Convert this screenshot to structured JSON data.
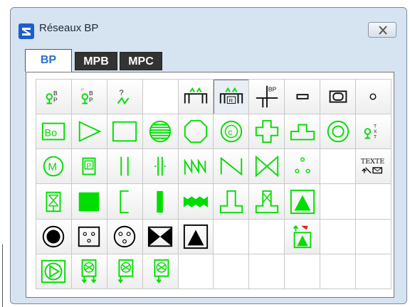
{
  "window": {
    "title": "Réseaux BP"
  },
  "tabs": [
    {
      "label": "BP",
      "active": true
    },
    {
      "label": "MPB",
      "active": false
    },
    {
      "label": "MPC",
      "active": false
    }
  ],
  "cells": [
    {
      "name": "bp-node-symbol",
      "icon": "bp-node"
    },
    {
      "name": "bp-node-alt-symbol",
      "icon": "bp-node-alt"
    },
    {
      "name": "fault-marker-symbol",
      "icon": "fault-marker"
    },
    {
      "name": "empty",
      "icon": "blank"
    },
    {
      "name": "span-aa-symbol",
      "icon": "span-aa"
    },
    {
      "name": "span-aa-r-symbol",
      "icon": "span-aa-r",
      "pressed": true
    },
    {
      "name": "bp-cross-symbol",
      "icon": "bp-cross"
    },
    {
      "name": "small-rect-symbol",
      "icon": "small-rect"
    },
    {
      "name": "box-symbol",
      "icon": "box"
    },
    {
      "name": "small-circle-symbol",
      "icon": "small-circle"
    },
    {
      "name": "bo-box-symbol",
      "icon": "bo-box"
    },
    {
      "name": "triangle-right-symbol",
      "icon": "triangle-right"
    },
    {
      "name": "rectangle-symbol",
      "icon": "rectangle"
    },
    {
      "name": "striped-circle-symbol",
      "icon": "striped-circle"
    },
    {
      "name": "octagon-symbol",
      "icon": "octagon"
    },
    {
      "name": "c-circle-symbol",
      "icon": "c-circle"
    },
    {
      "name": "cross-shape-symbol",
      "icon": "cross-shape"
    },
    {
      "name": "bump-shape-symbol",
      "icon": "bump-shape"
    },
    {
      "name": "double-circle-symbol",
      "icon": "double-circle"
    },
    {
      "name": "node-text-symbol",
      "icon": "node-text"
    },
    {
      "name": "m-circle-symbol",
      "icon": "m-circle"
    },
    {
      "name": "p-box-symbol",
      "icon": "p-box"
    },
    {
      "name": "double-line-symbol",
      "icon": "double-line"
    },
    {
      "name": "double-line-tick-symbol",
      "icon": "double-line-tick"
    },
    {
      "name": "zigzag-n-symbol",
      "icon": "zigzag-n"
    },
    {
      "name": "n-shape-symbol",
      "icon": "n-shape"
    },
    {
      "name": "bowtie-outline-symbol",
      "icon": "bowtie-outline"
    },
    {
      "name": "three-dots-symbol",
      "icon": "three-dots"
    },
    {
      "name": "empty",
      "icon": "blank"
    },
    {
      "name": "texte-symbol",
      "icon": "texte",
      "label": "TEXTE"
    },
    {
      "name": "valve-box-symbol",
      "icon": "valve-box"
    },
    {
      "name": "filled-square-symbol",
      "icon": "filled-square"
    },
    {
      "name": "bracket-symbol",
      "icon": "bracket"
    },
    {
      "name": "vertical-bar-symbol",
      "icon": "vertical-bar"
    },
    {
      "name": "filled-zigzag-symbol",
      "icon": "filled-zigzag"
    },
    {
      "name": "pedestal-symbol",
      "icon": "pedestal"
    },
    {
      "name": "pedestal-x-symbol",
      "icon": "pedestal-x"
    },
    {
      "name": "triangle-box-symbol",
      "icon": "triangle-box"
    },
    {
      "name": "empty",
      "icon": "blank"
    },
    {
      "name": "empty",
      "icon": "blank"
    },
    {
      "name": "black-target-symbol",
      "icon": "black-target"
    },
    {
      "name": "dotted-square-symbol",
      "icon": "dotted-square"
    },
    {
      "name": "dotted-circle-symbol",
      "icon": "dotted-circle"
    },
    {
      "name": "black-bowtie-symbol",
      "icon": "black-bowtie"
    },
    {
      "name": "black-triangle-box-symbol",
      "icon": "black-triangle-box"
    },
    {
      "name": "empty",
      "icon": "blank"
    },
    {
      "name": "empty",
      "icon": "blank"
    },
    {
      "name": "green-arrow-triangle-symbol",
      "icon": "green-arrow-triangle"
    },
    {
      "name": "empty",
      "icon": "blank"
    },
    {
      "name": "empty",
      "icon": "blank"
    },
    {
      "name": "pump-square-symbol",
      "icon": "pump-square"
    },
    {
      "name": "valve-arrows-symbol",
      "icon": "valve-arrows"
    },
    {
      "name": "valve-arrow-left-symbol",
      "icon": "valve-arrow-left"
    },
    {
      "name": "valve-arrow-down-symbol",
      "icon": "valve-arrow-down"
    },
    {
      "name": "empty",
      "icon": "blank"
    },
    {
      "name": "empty",
      "icon": "blank"
    },
    {
      "name": "empty",
      "icon": "blank"
    },
    {
      "name": "empty",
      "icon": "blank"
    },
    {
      "name": "empty",
      "icon": "blank"
    },
    {
      "name": "empty",
      "icon": "blank"
    }
  ],
  "colors": {
    "symbol": "#00dd00",
    "black": "#000000",
    "active_tab_text": "#2a6fd0"
  }
}
